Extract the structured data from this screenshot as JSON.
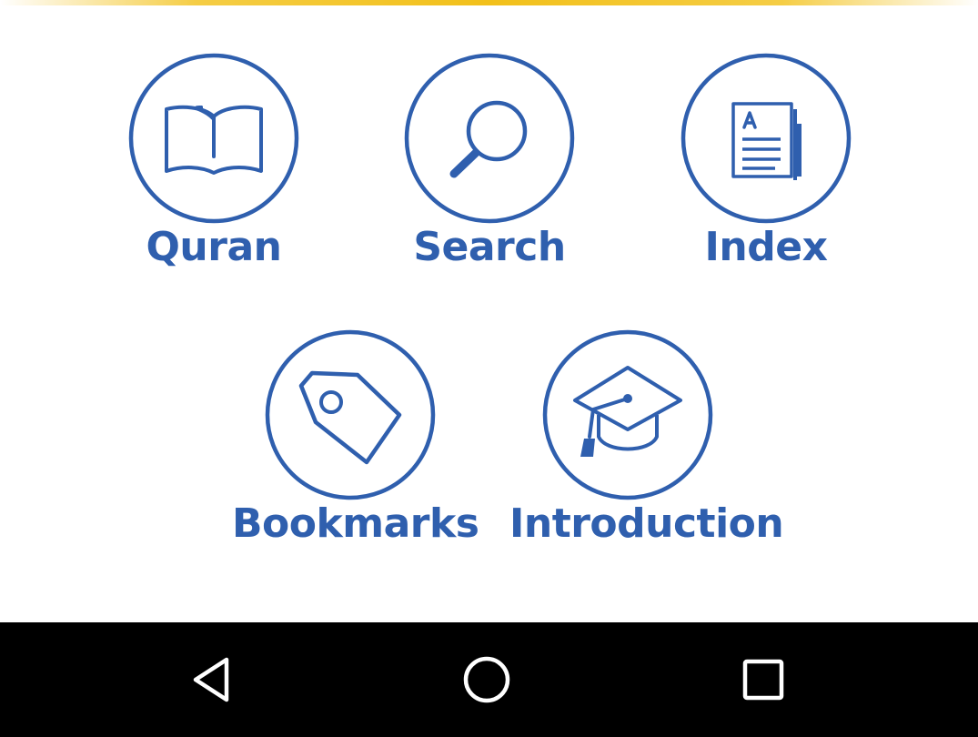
{
  "menu": {
    "items": [
      {
        "label": "Quran",
        "icon": "open-book-icon"
      },
      {
        "label": "Search",
        "icon": "magnifier-icon"
      },
      {
        "label": "Index",
        "icon": "index-document-icon"
      },
      {
        "label": "Bookmarks",
        "icon": "tag-icon"
      },
      {
        "label": "Introduction",
        "icon": "graduation-cap-icon"
      }
    ]
  },
  "navigation_bar": {
    "buttons": [
      {
        "icon": "back-triangle-icon"
      },
      {
        "icon": "home-circle-icon"
      },
      {
        "icon": "recent-apps-square-icon"
      }
    ]
  },
  "colors": {
    "primary_blue": "#2f5fae",
    "accent_yellow": "#f2c01a",
    "navbar_background": "#000000",
    "navbar_icon": "#ffffff"
  }
}
